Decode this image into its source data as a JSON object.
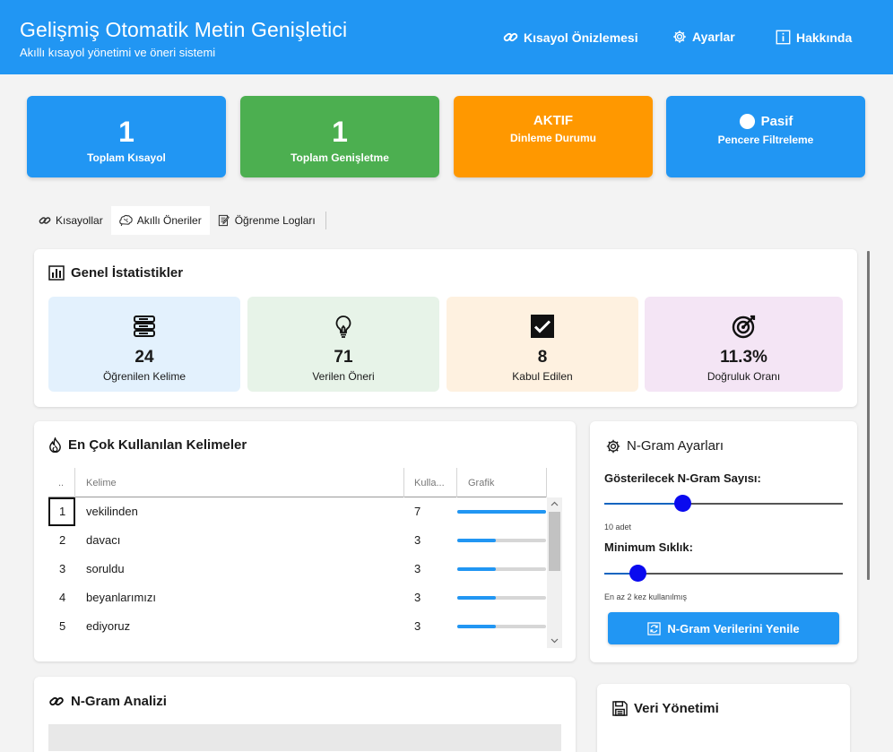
{
  "header": {
    "title": "Gelişmiş Otomatik Metin Genişletici",
    "subtitle": "Akıllı kısayol yönetimi ve öneri sistemi",
    "nav": [
      {
        "label": "Kısayol Önizlemesi",
        "icon": "link-icon"
      },
      {
        "label": "Ayarlar",
        "icon": "gear-icon"
      },
      {
        "label": "Hakkında",
        "icon": "info-icon"
      }
    ]
  },
  "stats": [
    {
      "value": "1",
      "label": "Toplam Kısayol",
      "color": "#2196f3"
    },
    {
      "value": "1",
      "label": "Toplam Genişletme",
      "color": "#4caf50"
    },
    {
      "value": "AKTIF",
      "label": "Dinleme Durumu",
      "color": "#ff9800"
    },
    {
      "value": "Pasif",
      "label": "Pencere Filtreleme",
      "color": "#2196f3",
      "icon": "white-circle-icon"
    }
  ],
  "tabs": [
    {
      "label": "Kısayollar",
      "icon": "link-icon",
      "active": false
    },
    {
      "label": "Akıllı Öneriler",
      "icon": "brain-icon",
      "active": true
    },
    {
      "label": "Öğrenme Logları",
      "icon": "memo-icon",
      "active": false
    }
  ],
  "general_stats": {
    "title": "Genel İstatistikler",
    "tiles": [
      {
        "value": "24",
        "label": "Öğrenilen Kelime",
        "icon": "books-icon",
        "color": "#e3f1fd"
      },
      {
        "value": "71",
        "label": "Verilen Öneri",
        "icon": "lightbulb-icon",
        "color": "#e7f3e8"
      },
      {
        "value": "8",
        "label": "Kabul Edilen",
        "icon": "check-box-icon",
        "color": "#fef1e0"
      },
      {
        "value": "11.3%",
        "label": "Doğruluk Oranı",
        "icon": "target-icon",
        "color": "#f4e5f5"
      }
    ]
  },
  "top_words": {
    "title": "En Çok Kullanılan Kelimeler",
    "columns": [
      "..",
      "Kelime",
      "Kulla...",
      "Grafik"
    ],
    "rows": [
      {
        "rank": "1",
        "word": "vekilinden",
        "count": "7",
        "ratio": 1.0
      },
      {
        "rank": "2",
        "word": "davacı",
        "count": "3",
        "ratio": 0.43
      },
      {
        "rank": "3",
        "word": "soruldu",
        "count": "3",
        "ratio": 0.43
      },
      {
        "rank": "4",
        "word": "beyanlarımızı",
        "count": "3",
        "ratio": 0.43
      },
      {
        "rank": "5",
        "word": "ediyoruz",
        "count": "3",
        "ratio": 0.43
      }
    ]
  },
  "ngram_settings": {
    "title": "N-Gram Ayarları",
    "count_label": "Gösterilecek N-Gram Sayısı:",
    "count_note": "10 adet",
    "count_level": 0.33,
    "freq_label": "Minimum Sıklık:",
    "freq_note": "En az 2 kez kullanılmış",
    "freq_level": 0.14,
    "refresh_label": "N-Gram Verilerini Yenile"
  },
  "ngram_analysis": {
    "title": "N-Gram Analizi"
  },
  "data_management": {
    "title": "Veri Yönetimi"
  }
}
